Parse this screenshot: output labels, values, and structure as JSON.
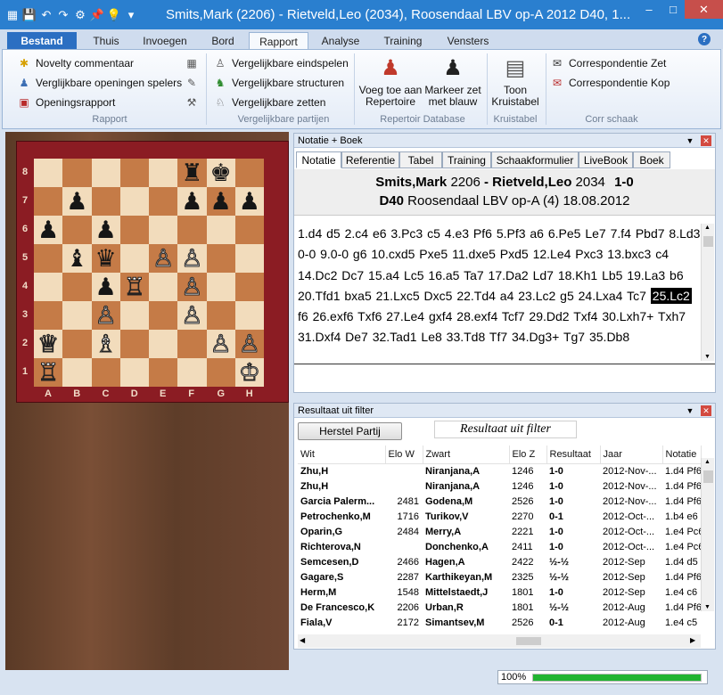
{
  "window": {
    "title": "Smits,Mark (2206) - Rietveld,Leo (2034), Roosendaal LBV op-A 2012  D40, 1...",
    "min": "–",
    "max": "□",
    "close": "✕"
  },
  "ribbon_tabs": [
    {
      "label": "Bestand"
    },
    {
      "label": "Thuis"
    },
    {
      "label": "Invoegen"
    },
    {
      "label": "Bord"
    },
    {
      "label": "Rapport"
    },
    {
      "label": "Analyse"
    },
    {
      "label": "Training"
    },
    {
      "label": "Vensters"
    }
  ],
  "help": "?",
  "ribbon": {
    "rapport_items": [
      "Novelty commentaar",
      "Verglijkbare openingen spelers",
      "Openingsrapport"
    ],
    "rapport_group": "Rapport",
    "vergelijkbare_items": [
      "Vergelijkbare eindspelen",
      "Vergelijkbare structuren",
      "Vergelijkbare zetten"
    ],
    "vergelijkbare_group": "Vergelijkbare partijen",
    "repertoire_btn1": "Voeg toe aan Repertoire",
    "repertoire_btn2": "Markeer zet met blauw",
    "repertoire_group": "Repertoir Database",
    "kruistabel_btn": "Toon Kruistabel",
    "kruistabel_group": "Kruistabel",
    "corr_items": [
      "Correspondentie Zet",
      "Correspondentie Kop"
    ],
    "corr_group": "Corr schaak"
  },
  "board": {
    "ranks": [
      "8",
      "7",
      "6",
      "5",
      "4",
      "3",
      "2",
      "1"
    ],
    "files": [
      "A",
      "B",
      "C",
      "D",
      "E",
      "F",
      "G",
      "H"
    ],
    "rows": [
      [
        "",
        "",
        "",
        "",
        "",
        "♜",
        "♚",
        ""
      ],
      [
        "",
        "♟",
        "",
        "",
        "",
        "♟",
        "♟",
        "♟"
      ],
      [
        "♟",
        "",
        "♟",
        "",
        "",
        "",
        "",
        ""
      ],
      [
        "",
        "♝",
        "♛",
        "",
        "♙",
        "♙",
        "",
        ""
      ],
      [
        "",
        "",
        "♟",
        "♖",
        "",
        "♙",
        "",
        ""
      ],
      [
        "",
        "",
        "♙",
        "",
        "",
        "♙",
        "",
        ""
      ],
      [
        "♕",
        "",
        "♗",
        "",
        "",
        "",
        "♙",
        "♙"
      ],
      [
        "♖",
        "",
        "",
        "",
        "",
        "",
        "",
        "♔"
      ]
    ]
  },
  "notation": {
    "pane_title": "Notatie + Boek",
    "tabs": [
      "Notatie",
      "Referentie",
      "Tabel",
      "Training",
      "Schaakformulier",
      "LiveBook",
      "Boek"
    ],
    "white": "Smits,Mark",
    "white_elo": "2206",
    "black": "Rietveld,Leo",
    "black_elo": "2034",
    "result": "1-0",
    "eco": "D40",
    "event": "Roosendaal LBV op-A (4) 18.08.2012",
    "moves_before": "1.d4 d5 2.c4 e6 3.Pc3 c5 4.e3 Pf6 5.Pf3 a6 6.Pe5 Le7 7.f4 Pbd7 8.Ld3 0-0 9.0-0 g6 10.cxd5 Pxe5 11.dxe5 Pxd5 12.Le4 Pxc3 13.bxc3 c4 14.Dc2 Dc7 15.a4 Lc5 16.a5 Ta7 17.Da2 Ld7 18.Kh1 Lb5 19.La3 b6 20.Tfd1 bxa5 21.Lxc5 Dxc5 22.Td4 a4 23.Lc2 g5 24.Lxa4 Tc7",
    "current_move": "25.Lc2",
    "moves_after": "f6 26.exf6 Txf6 27.Le4 gxf4 28.exf4 Tcf7 29.Dd2 Txf4 30.Lxh7+ Txh7 31.Dxf4 De7 32.Tad1 Le8 33.Td8 Tf7 34.Dg3+ Tg7 35.Db8"
  },
  "filter": {
    "pane_title": "Resultaat uit filter",
    "reset_button": "Herstel Partij",
    "label": "Resultaat uit filter",
    "columns": [
      "Wit",
      "Elo W",
      "Zwart",
      "Elo Z",
      "Resultaat",
      "Jaar",
      "Notatie"
    ],
    "rows": [
      [
        "Zhu,H",
        "",
        "Niranjana,A",
        "1246",
        "1-0",
        "2012-Nov-...",
        "1.d4 Pf6"
      ],
      [
        "Zhu,H",
        "",
        "Niranjana,A",
        "1246",
        "1-0",
        "2012-Nov-...",
        "1.d4 Pf6"
      ],
      [
        "Garcia Palerm...",
        "2481",
        "Godena,M",
        "2526",
        "1-0",
        "2012-Nov-...",
        "1.d4 Pf6"
      ],
      [
        "Petrochenko,M",
        "1716",
        "Turikov,V",
        "2270",
        "0-1",
        "2012-Oct-...",
        "1.b4 e6"
      ],
      [
        "Oparin,G",
        "2484",
        "Merry,A",
        "2221",
        "1-0",
        "2012-Oct-...",
        "1.e4 Pc6"
      ],
      [
        "Richterova,N",
        "",
        "Donchenko,A",
        "2411",
        "1-0",
        "2012-Oct-...",
        "1.e4 Pc6"
      ],
      [
        "Semcesen,D",
        "2466",
        "Hagen,A",
        "2422",
        "½-½",
        "2012-Sep",
        "1.d4 d5"
      ],
      [
        "Gagare,S",
        "2287",
        "Karthikeyan,M",
        "2325",
        "½-½",
        "2012-Sep",
        "1.d4 Pf6"
      ],
      [
        "Herm,M",
        "1548",
        "Mittelstaedt,J",
        "1801",
        "1-0",
        "2012-Sep",
        "1.e4 c6"
      ],
      [
        "De Francesco,K",
        "2206",
        "Urban,R",
        "1801",
        "½-½",
        "2012-Aug",
        "1.d4 Pf6"
      ],
      [
        "Fiala,V",
        "2172",
        "Simantsev,M",
        "2526",
        "0-1",
        "2012-Aug",
        "1.e4 c5"
      ]
    ]
  },
  "status": {
    "zoom": "100%",
    "progress": 1.0
  },
  "colors": {
    "titlebar": "#2a7fcf",
    "board_light": "#f2dcbc",
    "board_dark": "#c57b47",
    "frame": "#8b1c23",
    "progress": "#21b431"
  }
}
